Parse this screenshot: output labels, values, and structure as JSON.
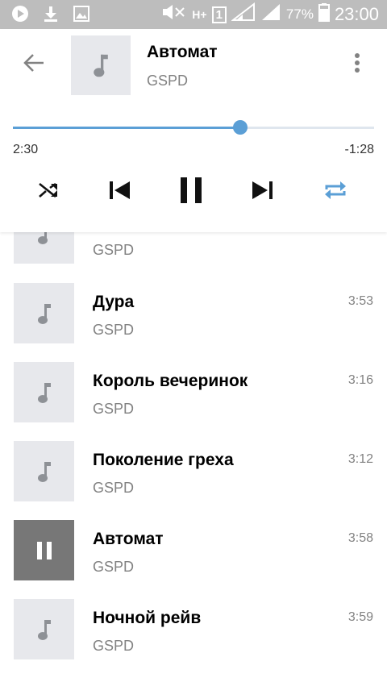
{
  "status_bar": {
    "battery": "77%",
    "time": "23:00",
    "network_label": "H+",
    "sim_label": "1"
  },
  "header": {
    "title": "Автомат",
    "artist": "GSPD"
  },
  "progress": {
    "elapsed": "2:30",
    "remaining": "-1:28",
    "fraction": 0.63
  },
  "controls": {
    "active_color": "#5b9fd6"
  },
  "tracks": [
    {
      "title": "",
      "artist": "GSPD",
      "duration": ""
    },
    {
      "title": "Дура",
      "artist": "GSPD",
      "duration": "3:53"
    },
    {
      "title": "Король вечеринок",
      "artist": "GSPD",
      "duration": "3:16"
    },
    {
      "title": "Поколение греха",
      "artist": "GSPD",
      "duration": "3:12"
    },
    {
      "title": "Автомат",
      "artist": "GSPD",
      "duration": "3:58"
    },
    {
      "title": "Ночной рейв",
      "artist": "GSPD",
      "duration": "3:59"
    }
  ]
}
